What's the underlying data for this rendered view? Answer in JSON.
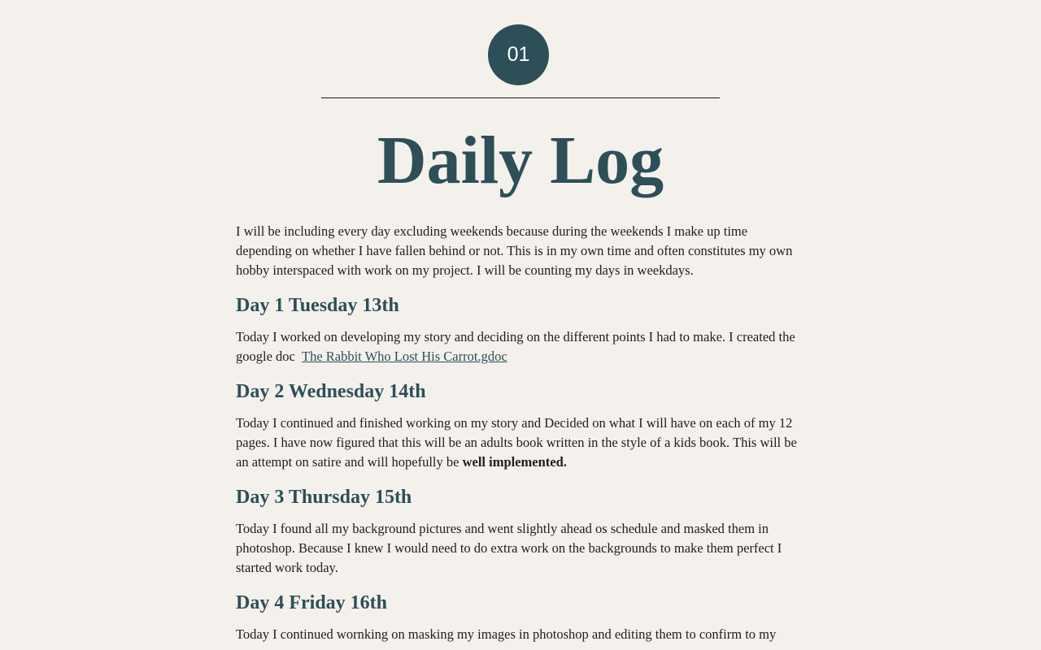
{
  "badge": "01",
  "title": "Daily Log",
  "intro": "I will be including every day excluding weekends because during the weekends I make up time depending on whether I have fallen behind or not. This is in my own time and often constitutes my own hobby interspaced with work on my project. I will be counting my days in weekdays.",
  "days": [
    {
      "heading": "Day 1 Tuesday 13th",
      "text": "Today I worked on developing my story and deciding on the different points I had to make. I created the google doc",
      "link": "The Rabbit Who Lost His Carrot.gdoc"
    },
    {
      "heading": "Day 2 Wednesday 14th",
      "text": "Today I continued and finished working on my story and Decided on what I will have on each of my 12 pages. I have now figured that this will be an adults book written in the style of a kids book. This will be an attempt on satire and will hopefully be",
      "bold": "well implemented."
    },
    {
      "heading": "Day 3 Thursday 15th",
      "text": "Today I found all my background pictures and went slightly ahead os schedule and masked them in photoshop. Because I knew I would need to do extra work on the backgrounds to make them perfect I started work today."
    },
    {
      "heading": "Day 4 Friday 16th",
      "text": "Today I continued wornking on masking my images in photoshop and editing them to confirm to my story."
    }
  ]
}
